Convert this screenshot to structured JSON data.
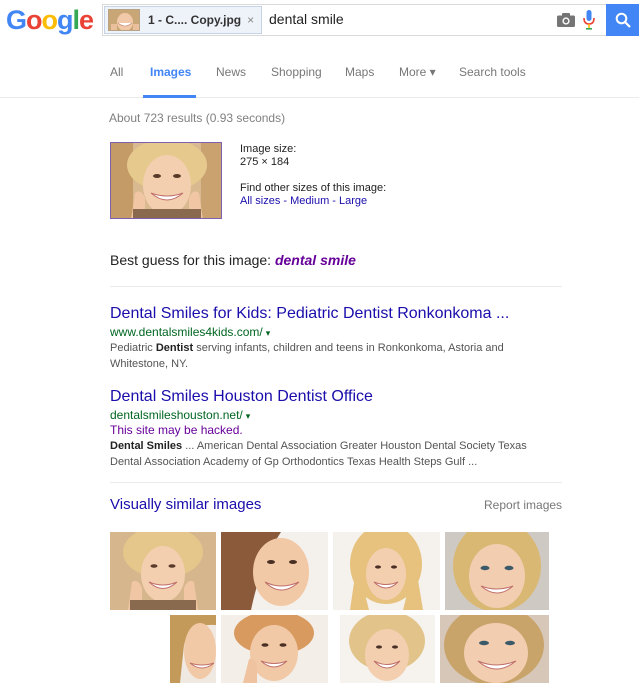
{
  "logo": {
    "letters": [
      "G",
      "o",
      "o",
      "g",
      "l",
      "e"
    ],
    "colors": [
      "#4285f4",
      "#ea4335",
      "#fbbc05",
      "#4285f4",
      "#34a853",
      "#ea4335"
    ]
  },
  "search": {
    "chip_label": "1 - C.... Copy.jpg",
    "chip_close": "×",
    "query": "dental smile",
    "icons": [
      "camera-icon",
      "microphone-icon",
      "search-icon"
    ]
  },
  "tabs": [
    {
      "label": "All",
      "active": false
    },
    {
      "label": "Images",
      "active": true
    },
    {
      "label": "News",
      "active": false
    },
    {
      "label": "Shopping",
      "active": false
    },
    {
      "label": "Maps",
      "active": false
    },
    {
      "label": "More ▾",
      "active": false
    },
    {
      "label": "Search tools",
      "active": false
    }
  ],
  "stats": "About 723 results (0.93 seconds)",
  "image_info": {
    "size_label": "Image size:",
    "size_value": "275 × 184",
    "other_sizes_label": "Find other sizes of this image:",
    "links": [
      "All sizes",
      "Medium",
      "Large"
    ],
    "separator": " - "
  },
  "best_guess": {
    "label": "Best guess for this image:",
    "value": "dental smile"
  },
  "results": [
    {
      "title": "Dental Smiles for Kids: Pediatric Dentist Ronkonkoma ...",
      "url": "www.dentalsmiles4kids.com/",
      "caret": "▾",
      "snippet_pre": "Pediatric ",
      "snippet_bold": "Dentist",
      "snippet_post": " serving infants, children and teens in Ronkonkoma, Astoria and Whitestone, NY."
    },
    {
      "title": "Dental Smiles Houston Dentist Office",
      "url": "dentalsmileshouston.net/",
      "caret": "▾",
      "warning": "This site may be hacked.",
      "snippet_pre": "",
      "snippet_bold": "Dental Smiles",
      "snippet_post": " ... American Dental Association Greater Houston Dental Society Texas Dental Association Academy of Gp Orthodontics Texas Health Steps Gulf ..."
    }
  ],
  "similar": {
    "heading": "Visually similar images",
    "report": "Report images"
  }
}
